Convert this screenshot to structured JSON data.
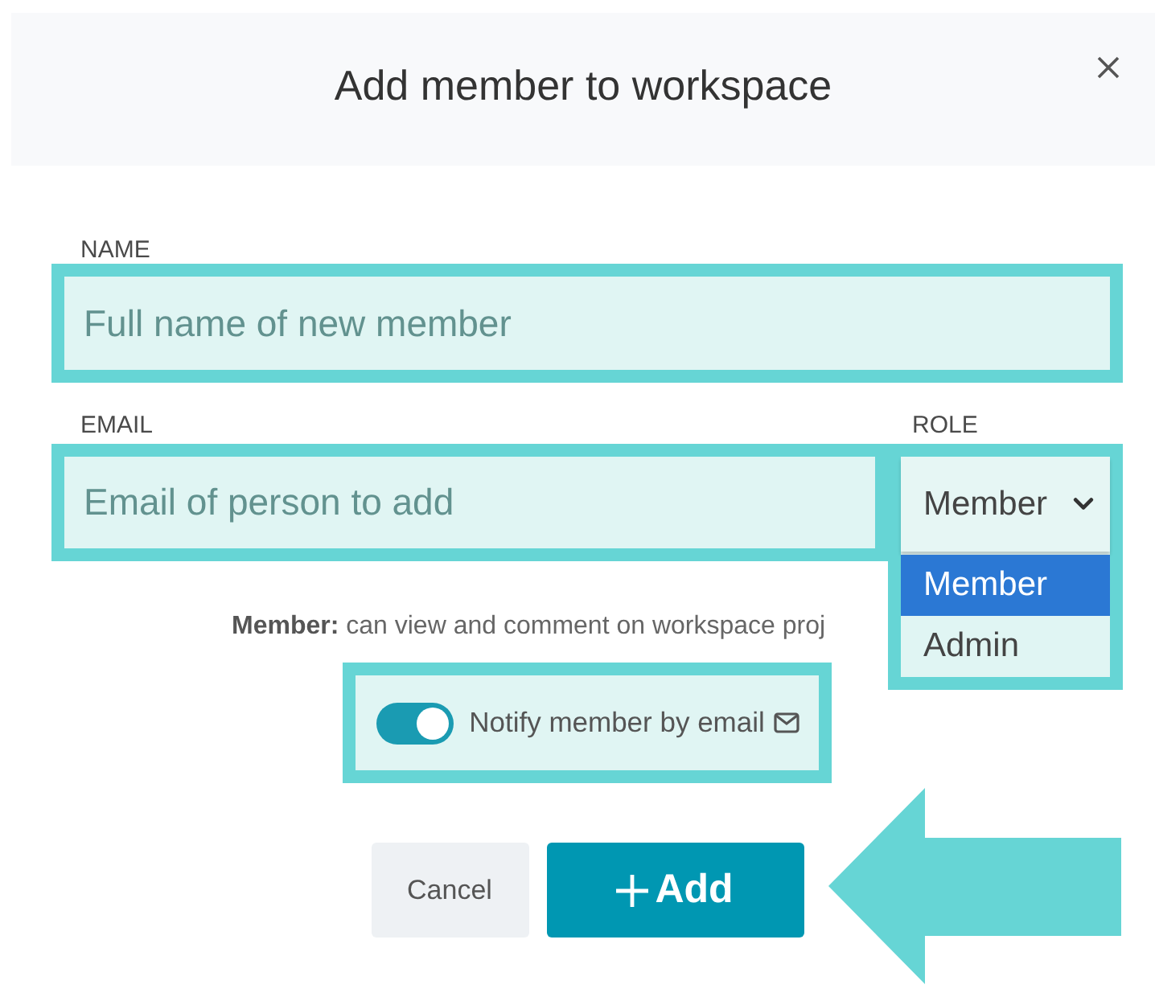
{
  "dialog": {
    "title": "Add member to workspace"
  },
  "name_field": {
    "label": "NAME",
    "placeholder": "Full name of new member",
    "highlighted": true
  },
  "email_field": {
    "label": "EMAIL",
    "placeholder": "Email of person to add",
    "highlighted": true
  },
  "role": {
    "label": "ROLE",
    "value": "Member",
    "expanded": true,
    "highlighted": true,
    "options": [
      {
        "label": "Member",
        "selected": true
      },
      {
        "label": "Admin",
        "selected": false
      }
    ]
  },
  "role_description": "**Member:** can view and comment on workspace proj",
  "notify": {
    "label": "Notify member by email",
    "on": true,
    "highlighted": true
  },
  "buttons": [
    {
      "kind": "secondary",
      "label": "Cancel",
      "arrow": false
    },
    {
      "kind": "primary",
      "label": "Add",
      "arrow": true
    }
  ]
}
